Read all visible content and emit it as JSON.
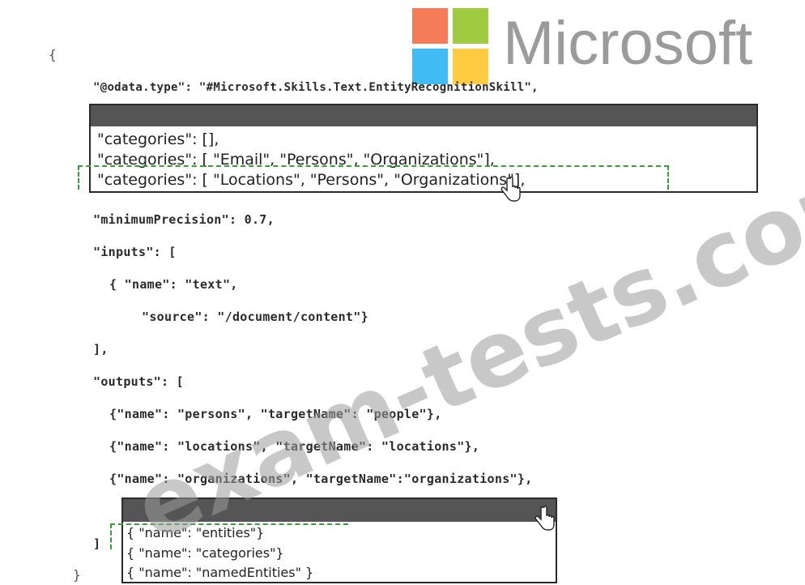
{
  "logo": {
    "wordmark": "Microsoft",
    "colors": [
      "#f25022",
      "#7fba00",
      "#00a4ef",
      "#ffb900"
    ]
  },
  "watermark": "exam-tests.com",
  "code": {
    "open_brace": "{",
    "odata_type": "\"@odata.type\": \"#Microsoft.Skills.Text.EntityRecognitionSkill\",",
    "minimum_precision": "\"minimumPrecision\": 0.7,",
    "inputs_open": "\"inputs\": [",
    "input_name": "{ \"name\": \"text\",",
    "input_source": "\"source\": \"/document/content\"}",
    "inputs_close": "],",
    "outputs_open": "\"outputs\": [",
    "output_persons": "{\"name\": \"persons\", \"targetName\": \"people\"},",
    "output_locations": "{\"name\": \"locations\", \"targetName\": \"locations\"},",
    "output_organizations": "{\"name\": \"organizations\", \"targetName\":\"organizations\"},",
    "outputs_close": "]",
    "close_brace": "}"
  },
  "categories_dropdown": {
    "options": [
      "\"categories\": [],",
      "\"categories\": [ \"Email\", \"Persons\", \"Organizations\"],",
      "\"categories\": [ \"Locations\", \"Persons\", \"Organizations\"],"
    ],
    "selected_index": 2
  },
  "outputs_dropdown": {
    "options": [
      "{ \"name\": \"entities\"}",
      "{ \"name\": \"categories\"}",
      "{ \"name\": \"namedEntities\" }"
    ],
    "selected_index": 0
  }
}
